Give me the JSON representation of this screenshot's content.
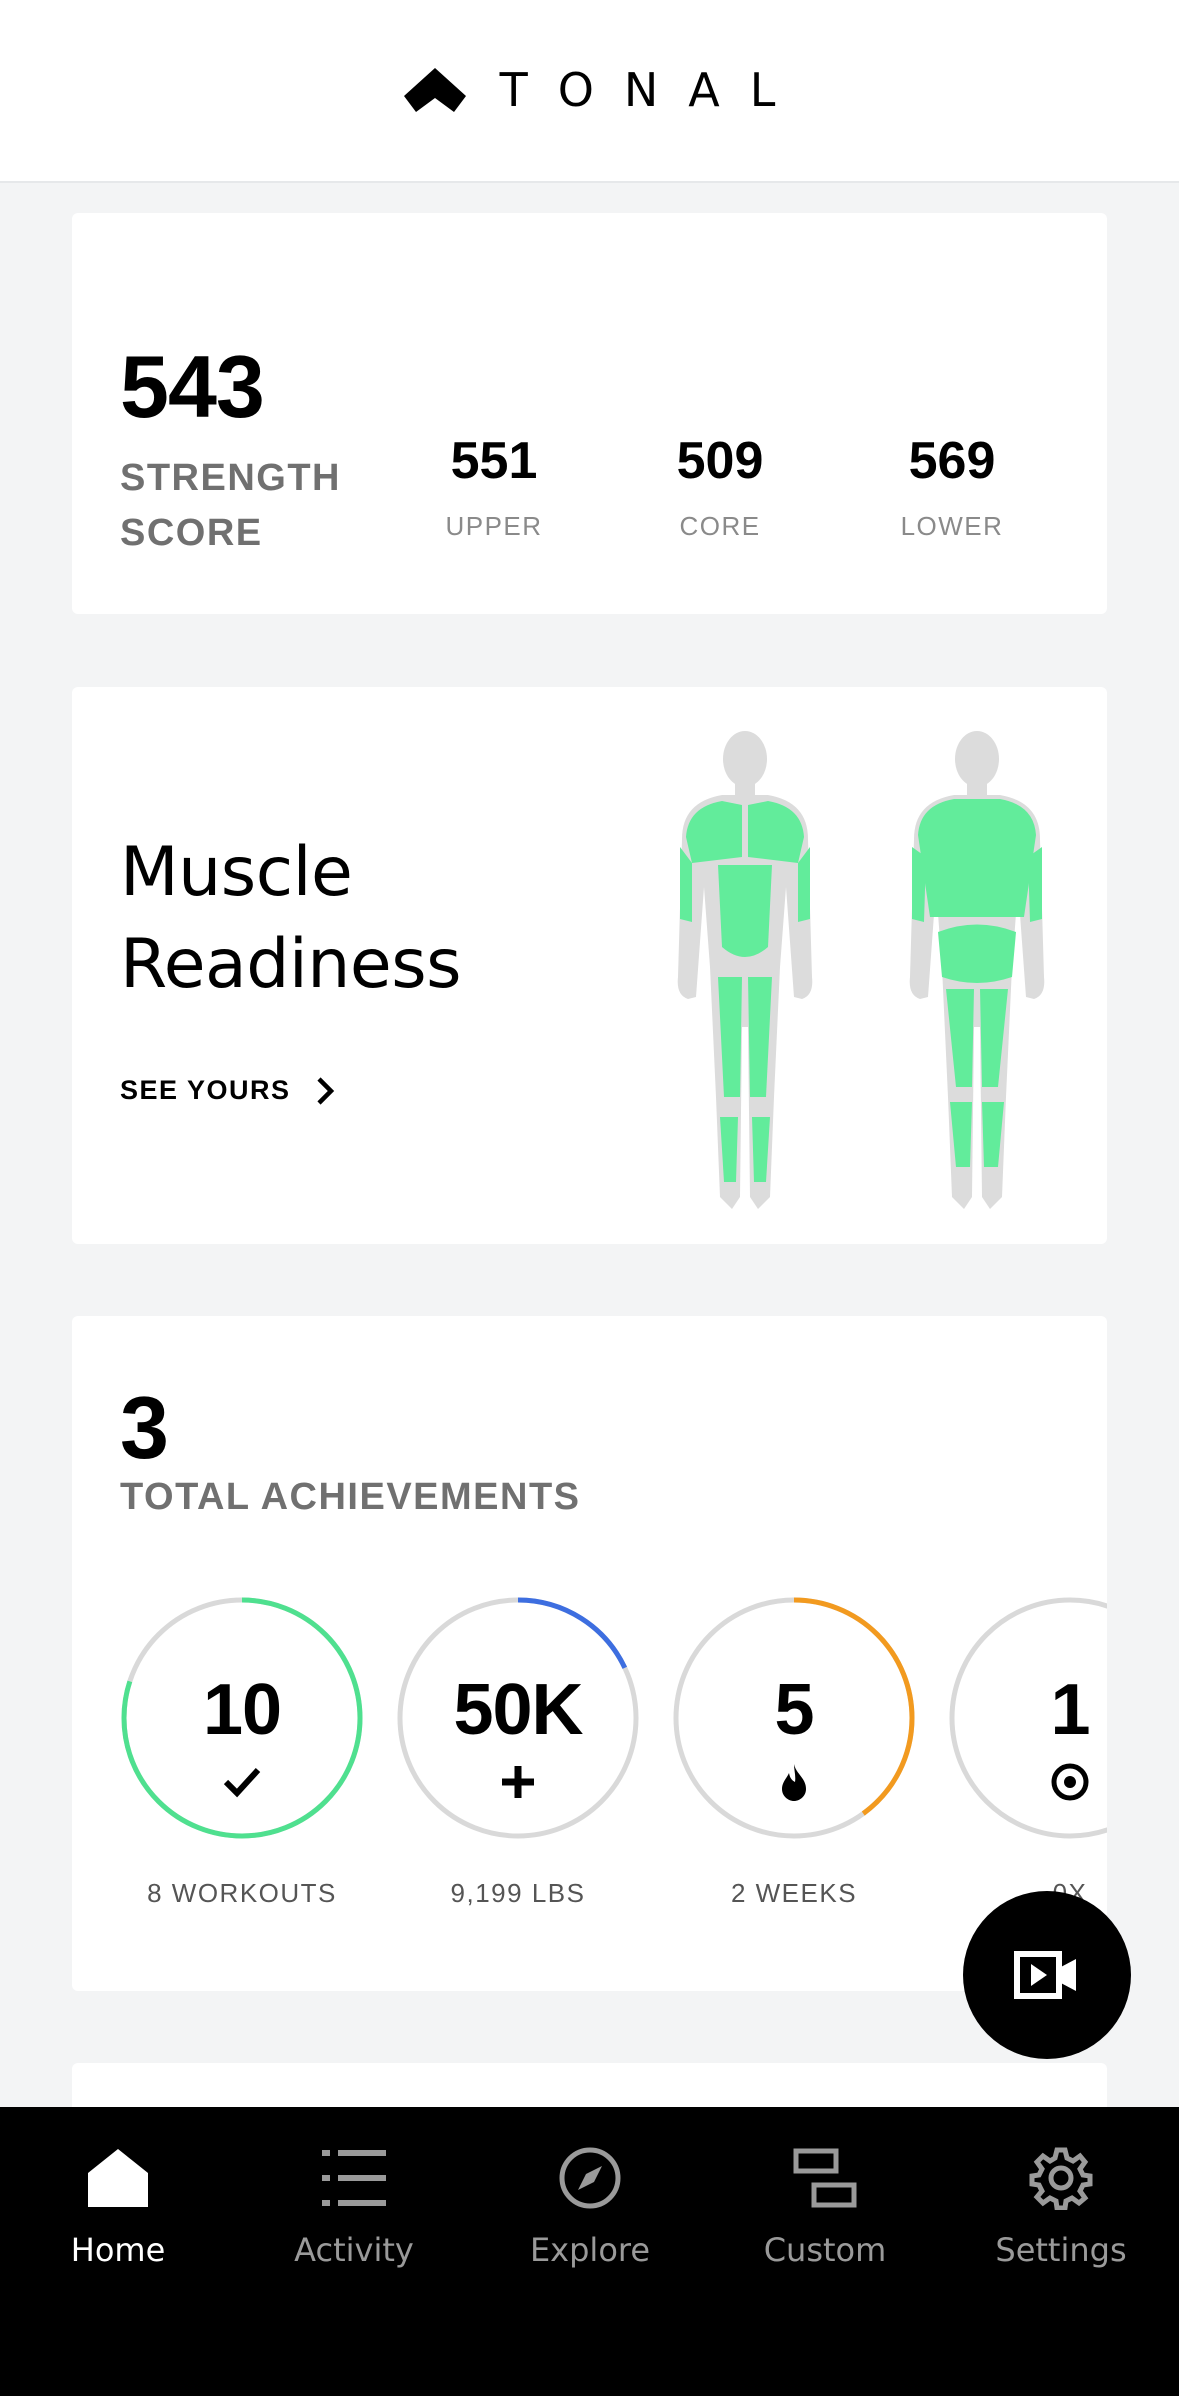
{
  "header": {
    "brand": "TONAL"
  },
  "strength": {
    "score": "543",
    "label": "STRENGTH SCORE",
    "breakdown": [
      {
        "value": "551",
        "label": "UPPER"
      },
      {
        "value": "509",
        "label": "CORE"
      },
      {
        "value": "569",
        "label": "LOWER"
      }
    ]
  },
  "muscle": {
    "title": "Muscle Readiness",
    "cta": "SEE YOURS",
    "ready_color": "#62ec9b"
  },
  "achievements": {
    "total": "3",
    "label": "TOTAL ACHIEVEMENTS",
    "badges": [
      {
        "value": "10",
        "icon": "check-icon",
        "caption": "8 WORKOUTS",
        "color": "#4fe08f",
        "progress": 0.8
      },
      {
        "value": "50K",
        "icon": "plus-icon",
        "caption": "9,199 LBS",
        "color": "#3d6ee0",
        "progress": 0.18
      },
      {
        "value": "5",
        "icon": "flame-icon",
        "caption": "2 WEEKS",
        "color": "#f29a1f",
        "progress": 0.4
      },
      {
        "value": "1",
        "icon": "target-icon",
        "caption": "0X",
        "color": "#d6d6d6",
        "progress": 0
      }
    ]
  },
  "fab": {
    "icon": "video-icon"
  },
  "tabs": [
    {
      "label": "Home",
      "icon": "home-icon",
      "active": true
    },
    {
      "label": "Activity",
      "icon": "list-icon",
      "active": false
    },
    {
      "label": "Explore",
      "icon": "compass-icon",
      "active": false
    },
    {
      "label": "Custom",
      "icon": "custom-blocks-icon",
      "active": false
    },
    {
      "label": "Settings",
      "icon": "gear-icon",
      "active": false
    }
  ]
}
